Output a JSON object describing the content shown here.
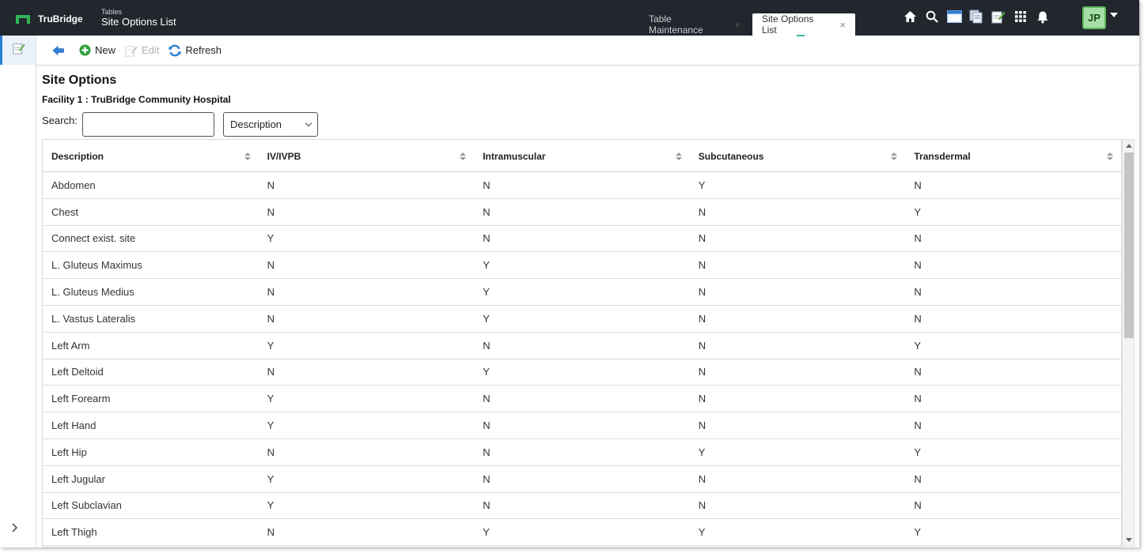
{
  "header": {
    "brand": "TruBridge",
    "section": "Tables",
    "app_title": "Site Options List",
    "tabs": [
      {
        "label": "Table Maintenance",
        "active": false
      },
      {
        "label": "Site Options List",
        "active": true
      }
    ],
    "tab_close_glyph": "×",
    "user_initials": "JP",
    "icons": [
      "home-icon",
      "search-icon",
      "window-icon",
      "documents-icon",
      "notes-icon",
      "apps-grid-icon",
      "bell-icon"
    ]
  },
  "toolbar": {
    "new_label": "New",
    "edit_label": "Edit",
    "refresh_label": "Refresh"
  },
  "page": {
    "title": "Site Options",
    "facility": "Facility 1 : TruBridge Community Hospital",
    "search_label": "Search:",
    "search_value": "",
    "search_field_selected": "Description"
  },
  "grid": {
    "columns": [
      "Description",
      "IV/IVPB",
      "Intramuscular",
      "Subcutaneous",
      "Transdermal"
    ],
    "rows": [
      [
        "Abdomen",
        "N",
        "N",
        "Y",
        "N"
      ],
      [
        "Chest",
        "N",
        "N",
        "N",
        "Y"
      ],
      [
        "Connect exist. site",
        "Y",
        "N",
        "N",
        "N"
      ],
      [
        "L. Gluteus Maximus",
        "N",
        "Y",
        "N",
        "N"
      ],
      [
        "L. Gluteus Medius",
        "N",
        "Y",
        "N",
        "N"
      ],
      [
        "L. Vastus Lateralis",
        "N",
        "Y",
        "N",
        "N"
      ],
      [
        "Left Arm",
        "Y",
        "N",
        "N",
        "Y"
      ],
      [
        "Left Deltoid",
        "N",
        "Y",
        "N",
        "N"
      ],
      [
        "Left Forearm",
        "Y",
        "N",
        "N",
        "N"
      ],
      [
        "Left Hand",
        "Y",
        "N",
        "N",
        "N"
      ],
      [
        "Left Hip",
        "N",
        "N",
        "Y",
        "Y"
      ],
      [
        "Left Jugular",
        "Y",
        "N",
        "N",
        "N"
      ],
      [
        "Left Subclavian",
        "Y",
        "N",
        "N",
        "N"
      ],
      [
        "Left Thigh",
        "N",
        "Y",
        "Y",
        "Y"
      ]
    ]
  },
  "colors": {
    "topbar": "#22272e",
    "brand_green": "#2fb457",
    "accent_blue": "#2d7fd2"
  }
}
